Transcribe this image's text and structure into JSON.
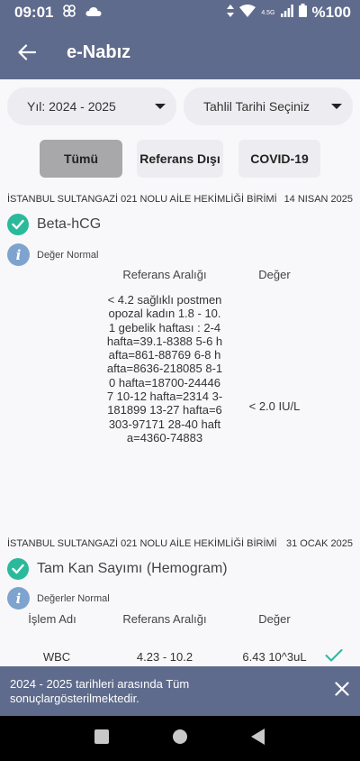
{
  "status_bar": {
    "time": "09:01",
    "network_type": "4.5G",
    "battery": "%100"
  },
  "app_bar": {
    "title": "e-Nabız"
  },
  "filters": {
    "year": "Yıl: 2024 - 2025",
    "date_picker": "Tahlil Tarihi Seçiniz"
  },
  "tabs": [
    {
      "label": "Tümü",
      "active": true
    },
    {
      "label": "Referans Dışı",
      "active": false
    },
    {
      "label": "COVID-19",
      "active": false
    }
  ],
  "results": [
    {
      "facility": "İSTANBUL SULTANGAZİ 021 NOLU AİLE HEKİMLİĞİ BİRİMİ",
      "date": "14 NISAN 2025",
      "test_name": "Beta-hCG",
      "status": "Değer Normal",
      "col_reference": "Referans Aralığı",
      "col_value": "Değer",
      "reference": "< 4.2 sağlıklı postmenopozal kadın 1.8 - 10.1 gebelik haftası : 2-4 hafta=39.1-8388 5-6 hafta=861-88769 6-8 hafta=8636-218085 8-10 hafta=18700-244467 10-12 hafta=2314 3-181899 13-27 hafta=6303-97171 28-40 hafta=4360-74883",
      "value": "< 2.0 IU/L"
    },
    {
      "facility": "İSTANBUL SULTANGAZİ 021 NOLU AİLE HEKİMLİĞİ BİRİMİ",
      "date": "31 OCAK 2025",
      "test_name": "Tam Kan Sayımı (Hemogram)",
      "status": "Değerler Normal",
      "col_name": "İşlem Adı",
      "col_reference": "Referans Aralığı",
      "col_value": "Değer",
      "rows": [
        {
          "name": "WBC",
          "reference": "4.23 - 10.2",
          "value": "6.43 10^3uL"
        }
      ]
    }
  ],
  "snackbar": {
    "text": "2024 - 2025 tarihleri arasında Tüm sonuçlargösterilmektedir."
  },
  "colors": {
    "primary": "#5f6b8c",
    "success": "#2bb99b",
    "info": "#7ea3cf",
    "tab_active": "#a8a8ab",
    "tab_inactive": "#ededf1"
  }
}
